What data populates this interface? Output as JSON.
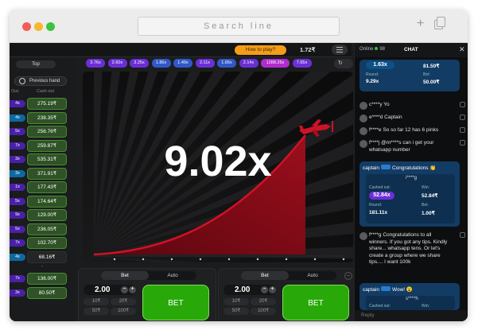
{
  "browser": {
    "url_placeholder": "Search line"
  },
  "header": {
    "how_to_play": "How to play?",
    "balance": "1.72₹"
  },
  "left_panel": {
    "top_tab": "Top",
    "previous_hand": "Previous hand",
    "col_mult": "Out.",
    "col_cashout": "Cash out",
    "rows": [
      {
        "mult": "4x",
        "cash": "275.19₹",
        "hl": false,
        "dark": false
      },
      {
        "mult": "4x",
        "cash": "238.35₹",
        "hl": true,
        "dark": false
      },
      {
        "mult": "5x",
        "cash": "256.76₹",
        "hl": false,
        "dark": false
      },
      {
        "mult": "7x",
        "cash": "259.87₹",
        "hl": false,
        "dark": false
      },
      {
        "mult": "3x",
        "cash": "535.31₹",
        "hl": false,
        "dark": false
      },
      {
        "mult": "3x",
        "cash": "371.91₹",
        "hl": true,
        "dark": false
      },
      {
        "mult": "1x",
        "cash": "177.43₹",
        "hl": false,
        "dark": false
      },
      {
        "mult": "5x",
        "cash": "174.64₹",
        "hl": false,
        "dark": false
      },
      {
        "mult": "9x",
        "cash": "129.00₹",
        "hl": false,
        "dark": false
      },
      {
        "mult": "5x",
        "cash": "236.05₹",
        "hl": false,
        "dark": false
      },
      {
        "mult": "7x",
        "cash": "102.70₹",
        "hl": false,
        "dark": false
      },
      {
        "mult": "4x",
        "cash": "68.16₹",
        "hl": true,
        "dark": true
      }
    ],
    "rows_after": [
      {
        "mult": "7x",
        "cash": "136.00₹",
        "hl": false,
        "dark": false
      },
      {
        "mult": "3x",
        "cash": "80.50₹",
        "hl": false,
        "dark": false
      }
    ],
    "separator": "-"
  },
  "history": [
    {
      "value": "3.76x",
      "color": "purple"
    },
    {
      "value": "2.60x",
      "color": "purple"
    },
    {
      "value": "3.25x",
      "color": "purple"
    },
    {
      "value": "1.86x",
      "color": "blue"
    },
    {
      "value": "1.49x",
      "color": "blue"
    },
    {
      "value": "2.11x",
      "color": "purple"
    },
    {
      "value": "1.65x",
      "color": "blue"
    },
    {
      "value": "2.14x",
      "color": "purple"
    },
    {
      "value": "1288.25x",
      "color": "magenta"
    },
    {
      "value": "7.65x",
      "color": "purple"
    }
  ],
  "game": {
    "multiplier": "9.02x",
    "colors": {
      "curve": "#b10f1e",
      "plane": "#d01226"
    }
  },
  "bet_panels": [
    {
      "toggle_bet": "Bet",
      "toggle_auto": "Auto",
      "amount": "2.00",
      "quick": [
        "10₹",
        "20₹",
        "50₹",
        "100₹"
      ],
      "button": "BET"
    },
    {
      "toggle_bet": "Bet",
      "toggle_auto": "Auto",
      "amount": "2.00",
      "quick": [
        "10₹",
        "20₹",
        "50₹",
        "100₹"
      ],
      "button": "BET"
    }
  ],
  "chat": {
    "online_label": "Online",
    "online_count": "98",
    "title": "CHAT",
    "win_card": {
      "mult": "1.63x",
      "amount": "81.50₹",
      "round_label": "Round:",
      "round_value": "9.29x",
      "bet_label": "Bet:",
      "bet_value": "50.00₹"
    },
    "messages": [
      {
        "text": "c****y Yo"
      },
      {
        "text": "e****d Captain"
      },
      {
        "text": "f****e So so far 12 has 6 pinks"
      },
      {
        "text": "f****j @m****s can i get your whatsapp number"
      }
    ],
    "captain_card": {
      "name": "captain",
      "text": "Congratulations 👏",
      "user": "i****g",
      "cashed_label": "Cashed out:",
      "cashed_value": "52.84x",
      "win_label": "Win:",
      "win_value": "52.84₹",
      "round_label": "Round:",
      "round_value": "181.11x",
      "bet_label": "Bet:",
      "bet_value": "1.00₹"
    },
    "long_message": "f****g Congratulations to all winners. If you got any tips. Kindly share... whatsapp tens. Or let's create a group where we share tips.... I want 100k",
    "captain_card2": {
      "name": "captain",
      "text": "Wow! 😮",
      "user": "s****h",
      "cashed_label": "Cashed out:",
      "win_label": "Win:"
    },
    "reply": "Reply"
  }
}
